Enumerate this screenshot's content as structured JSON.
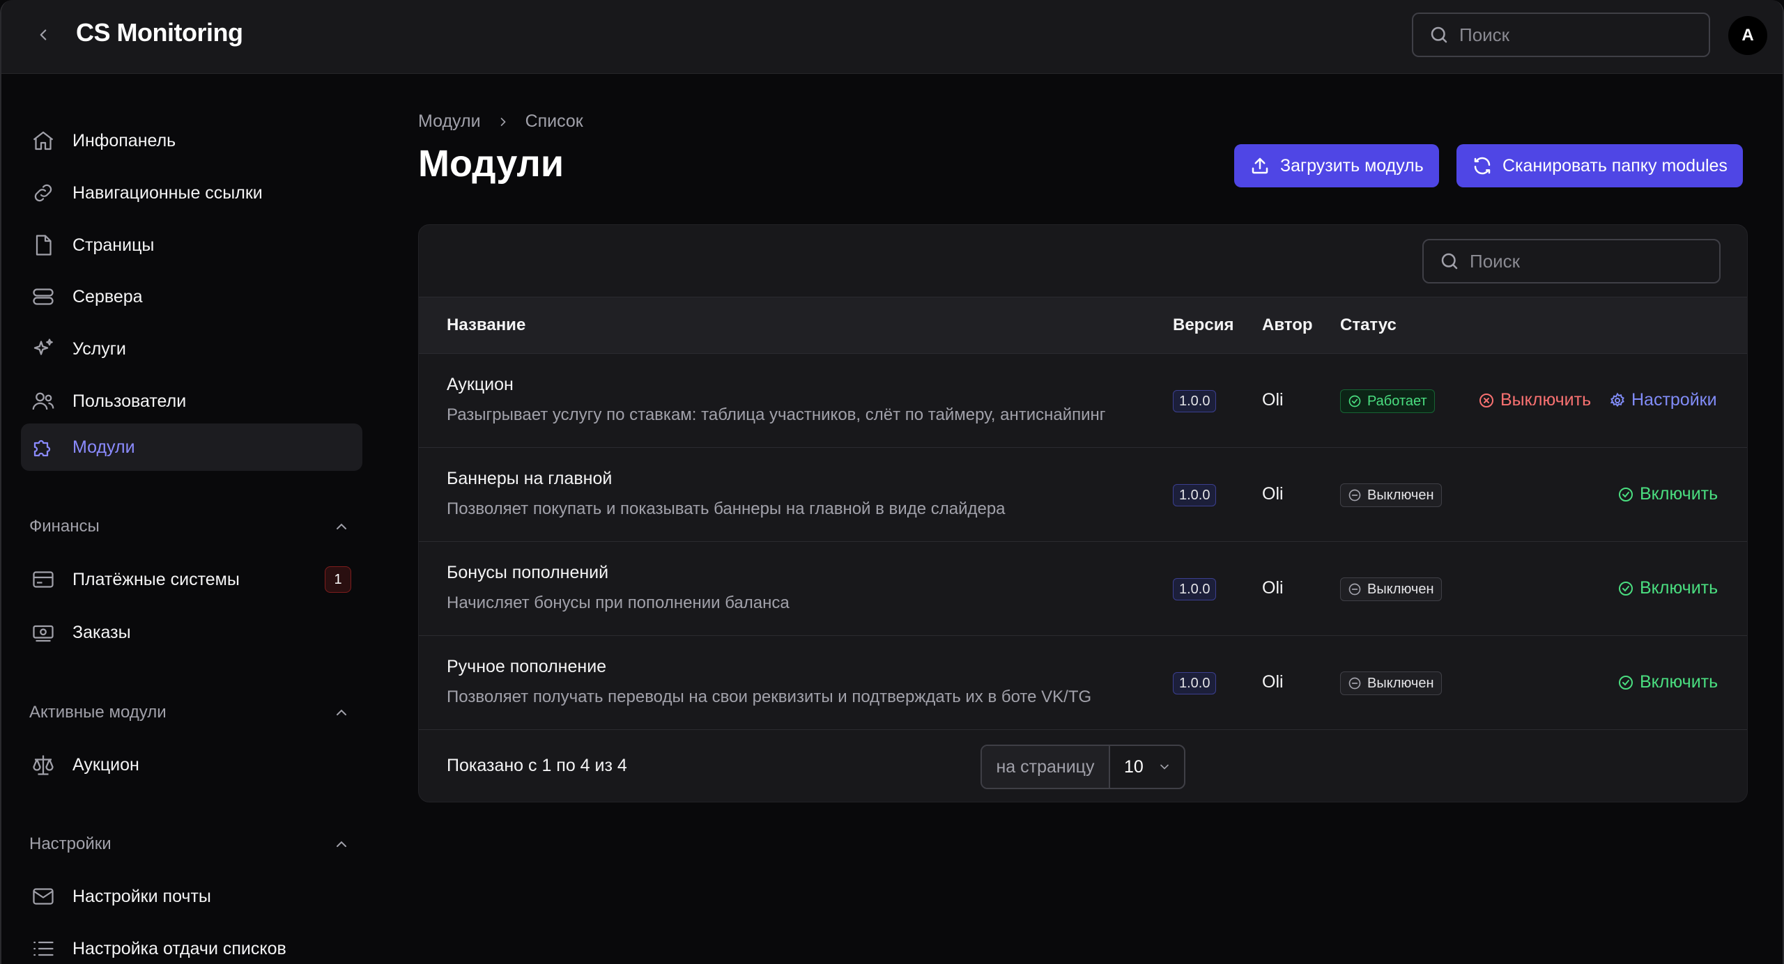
{
  "app": {
    "title": "CS Monitoring",
    "avatar_letter": "A"
  },
  "top_search": {
    "placeholder": "Поиск"
  },
  "sidebar": {
    "items": [
      {
        "label": "Инфопанель",
        "icon": "home-icon"
      },
      {
        "label": "Навигационные ссылки",
        "icon": "link-icon"
      },
      {
        "label": "Страницы",
        "icon": "file-icon"
      },
      {
        "label": "Сервера",
        "icon": "server-icon"
      },
      {
        "label": "Услуги",
        "icon": "sparkles-icon"
      },
      {
        "label": "Пользователи",
        "icon": "users-icon"
      },
      {
        "label": "Модули",
        "icon": "puzzle-icon",
        "active": true
      }
    ],
    "sections": [
      {
        "title": "Финансы",
        "items": [
          {
            "label": "Платёжные системы",
            "badge": "1"
          },
          {
            "label": "Заказы"
          }
        ]
      },
      {
        "title": "Активные модули",
        "items": [
          {
            "label": "Аукцион"
          }
        ]
      },
      {
        "title": "Настройки",
        "items": [
          {
            "label": "Настройки почты"
          },
          {
            "label": "Настройка отдачи списков"
          }
        ]
      }
    ]
  },
  "breadcrumbs": [
    "Модули",
    "Список"
  ],
  "page": {
    "title": "Модули",
    "upload_label": "Загрузить модуль",
    "scan_label": "Сканировать папку modules"
  },
  "table": {
    "search_placeholder": "Поиск",
    "headers": {
      "name": "Название",
      "version": "Версия",
      "author": "Автор",
      "status": "Статус"
    },
    "rows": [
      {
        "name": "Аукцион",
        "desc": "Разыгрывает услугу по ставкам: таблица участников, слёт по таймеру, антиснайпинг",
        "version": "1.0.0",
        "author": "Oli",
        "status": "Работает",
        "action": "Выключить",
        "settings": "Настройки"
      },
      {
        "name": "Баннеры на главной",
        "desc": "Позволяет покупать и показывать баннеры на главной в виде слайдера",
        "version": "1.0.0",
        "author": "Oli",
        "status": "Выключен",
        "action": "Включить"
      },
      {
        "name": "Бонусы пополнений",
        "desc": "Начисляет бонусы при пополнении баланса",
        "version": "1.0.0",
        "author": "Oli",
        "status": "Выключен",
        "action": "Включить"
      },
      {
        "name": "Ручное пополнение",
        "desc": "Позволяет получать переводы на свои реквизиты и подтверждать их в боте VK/TG",
        "version": "1.0.0",
        "author": "Oli",
        "status": "Выключен",
        "action": "Включить"
      }
    ],
    "footer": {
      "shown": "Показано с 1 по 4 из 4",
      "per_page_label": "на страницу",
      "per_page_value": "10"
    }
  },
  "colors": {
    "accent": "#4f46e5",
    "active_nav": "#8b8bff",
    "ok": "#4ade80",
    "danger": "#f87171"
  }
}
